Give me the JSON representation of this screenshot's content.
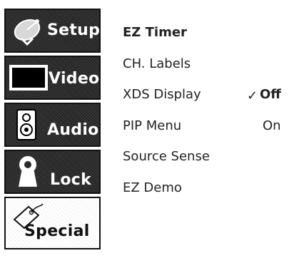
{
  "tabs": [
    {
      "label": "Setup",
      "icon": "satellite-dish-icon",
      "selected": false
    },
    {
      "label": "Video",
      "icon": "tv-screen-icon",
      "selected": false
    },
    {
      "label": "Audio",
      "icon": "speaker-icon",
      "selected": false
    },
    {
      "label": "Lock",
      "icon": "keyhole-icon",
      "selected": false
    },
    {
      "label": "Special",
      "icon": "tag-icon",
      "selected": true
    }
  ],
  "menu": {
    "items": [
      "EZ Timer",
      "CH. Labels",
      "XDS Display",
      "PIP Menu",
      "Source Sense",
      "EZ Demo"
    ],
    "active_index": 0
  },
  "xds_options": {
    "check_mark": "✓",
    "off_label": "Off",
    "on_label": "On",
    "selected": "Off"
  },
  "colors": {
    "tab_background": "#2a2a2a",
    "selected_tab_background": "#ffffff",
    "text": "#222222"
  }
}
